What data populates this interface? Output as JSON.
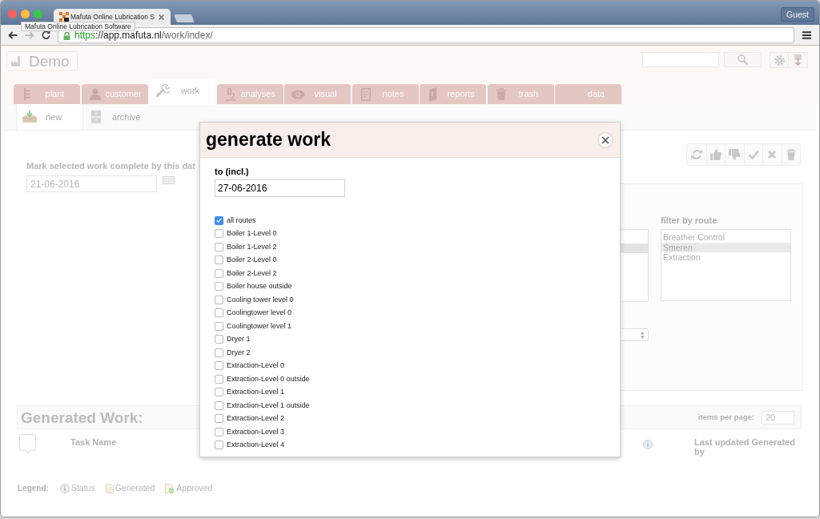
{
  "browser": {
    "tab_title": "Mafuta Online Lubrication S",
    "tooltip": "Mafuta Online Lubrication Software",
    "profile": "Guest",
    "url": {
      "scheme": "https",
      "host": "://app.mafuta.nl",
      "path": "/work/index/"
    }
  },
  "header": {
    "site": "Demo"
  },
  "tabs": [
    {
      "label": "plant",
      "selected": false
    },
    {
      "label": "customer",
      "selected": false
    },
    {
      "label": "work",
      "selected": true
    },
    {
      "label": "analyses",
      "selected": false
    },
    {
      "label": "visual",
      "selected": false
    },
    {
      "label": "notes",
      "selected": false
    },
    {
      "label": "reports",
      "selected": false
    },
    {
      "label": "trash",
      "selected": false
    },
    {
      "label": "data",
      "selected": false
    }
  ],
  "subtabs": [
    {
      "label": "new",
      "selected": true
    },
    {
      "label": "archive",
      "selected": false
    }
  ],
  "complete_by": {
    "label": "Mark selected work complete by this dat",
    "value": "21-06-2016"
  },
  "route_panel": {
    "list_1": {
      "rows": [
        {
          "selected": false
        },
        {
          "selected": true
        },
        {
          "selected": false
        }
      ]
    },
    "filter_label": "filter by route",
    "routes": [
      {
        "label": "Breather Control",
        "selected": false
      },
      {
        "label": "Smeren",
        "selected": true
      },
      {
        "label": "Extraction",
        "selected": false
      }
    ]
  },
  "generated_work": {
    "title": "Generated Work:",
    "items_per_page_label": "items per page:",
    "items_per_page": "20"
  },
  "table": {
    "columns": [
      {
        "kind": "select"
      },
      {
        "kind": "text",
        "label": "Task Name"
      },
      {
        "kind": "status"
      },
      {
        "kind": "text",
        "label": "Last updated Generated by"
      }
    ]
  },
  "legend": {
    "label": "Legend:",
    "items": [
      {
        "kind": "status",
        "label": "Status"
      },
      {
        "kind": "generated",
        "label": "Generated"
      },
      {
        "kind": "approved",
        "label": "Approved"
      }
    ]
  },
  "dialog": {
    "title": "generate work",
    "date_label": "to (incl.)",
    "date_value": "27-06-2016",
    "routes": [
      {
        "label": "all routes",
        "checked": true
      },
      {
        "label": "Boiler 1-Level 0",
        "checked": false
      },
      {
        "label": "Boiler 1-Level 2",
        "checked": false
      },
      {
        "label": "Boiler 2-Level 0",
        "checked": false
      },
      {
        "label": "Boiler 2-Level 2",
        "checked": false
      },
      {
        "label": "Boiler house outside",
        "checked": false
      },
      {
        "label": "Cooling tower level 0",
        "checked": false
      },
      {
        "label": "Coolingtower level 0",
        "checked": false
      },
      {
        "label": "Coolingtower level 1",
        "checked": false
      },
      {
        "label": "Dryer 1",
        "checked": false
      },
      {
        "label": "Dryer 2",
        "checked": false
      },
      {
        "label": "Extraction-Level 0",
        "checked": false
      },
      {
        "label": "Extraction-Level 0 outside",
        "checked": false
      },
      {
        "label": "Extraction-Level 1",
        "checked": false
      },
      {
        "label": "Extraction-Level 1 outside",
        "checked": false
      },
      {
        "label": "Extraction-Level 2",
        "checked": false
      },
      {
        "label": "Extraction-Level 3",
        "checked": false
      },
      {
        "label": "Extraction-Level 4",
        "checked": false
      }
    ]
  }
}
